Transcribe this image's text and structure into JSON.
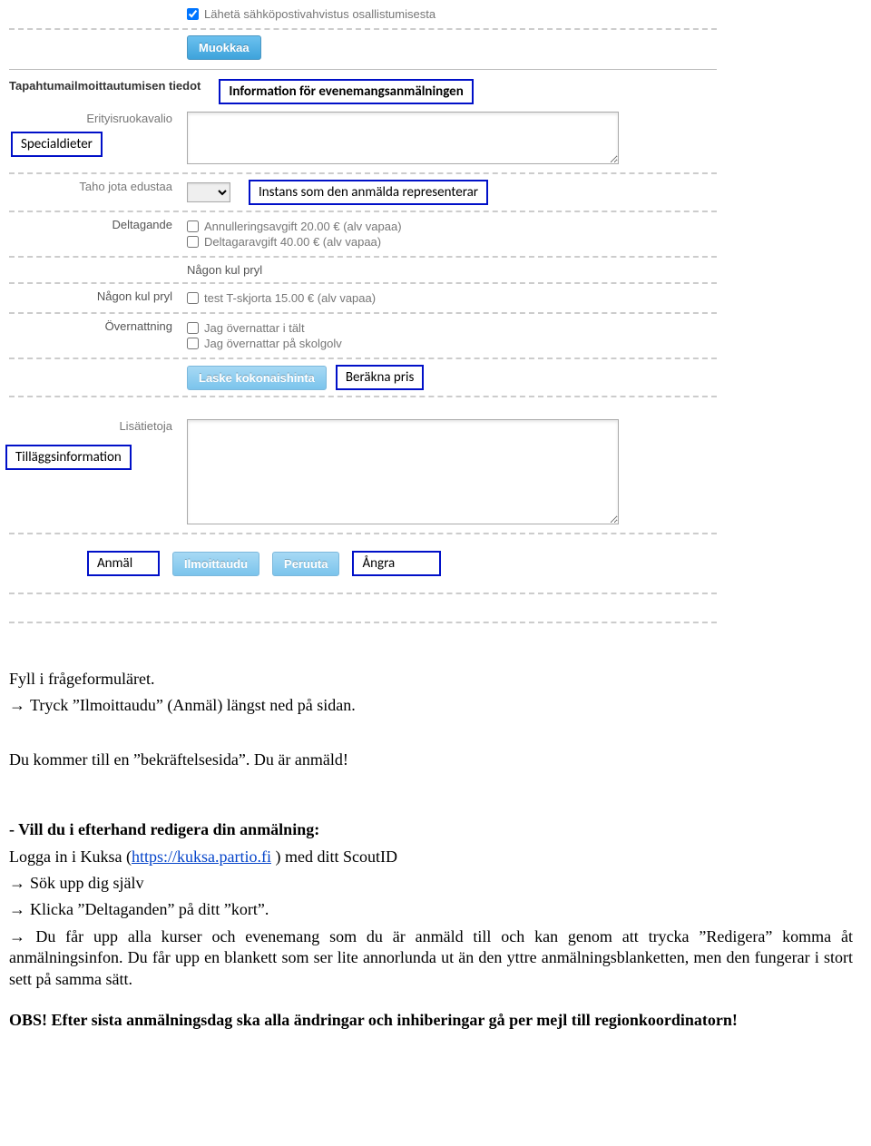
{
  "row_email": {
    "label": "Lähetä sähköpostivahvistus osallistumisesta"
  },
  "btn_muokkaa": "Muokkaa",
  "section_info": {
    "title": "Tapahtumailmoittautumisen tiedot",
    "callout": "Information för evenemangsanmälningen"
  },
  "row_diet": {
    "label": "Erityisruokavalio",
    "callout": "Specialdieter"
  },
  "row_represent": {
    "label": "Taho jota edustaa",
    "callout": "Instans som den anmälda representerar"
  },
  "row_participation": {
    "label": "Deltagande",
    "opt1": "Annulleringsavgift 20.00 € (alv vapaa)",
    "opt2": "Deltagaravgift 40.00 € (alv vapaa)"
  },
  "row_pryl_header": "Någon kul pryl",
  "row_pryl": {
    "label": "Någon kul pryl",
    "opt": "test T-skjorta 15.00 € (alv vapaa)"
  },
  "row_overnight": {
    "label": "Övernattning",
    "opt1": "Jag övernattar i tält",
    "opt2": "Jag övernattar på skolgolv"
  },
  "btn_calc": "Laske kokonaishinta",
  "calc_callout": "Beräkna pris",
  "row_info": {
    "label": "Lisätietoja",
    "callout": "Tilläggsinformation"
  },
  "submit": {
    "anmal_callout": "Anmäl",
    "ilmoittaudu": "Ilmoittaudu",
    "peruuta": "Peruuta",
    "angra_callout": "Ångra"
  },
  "doc": {
    "p1": "Fyll i frågeformuläret.",
    "p2": "Tryck ”Ilmoittaudu” (Anmäl) längst ned på sidan.",
    "p3": "Du kommer till en ”bekräftelsesida”. Du är anmäld!",
    "h1": "- Vill du i efterhand redigera din anmälning:",
    "p4a": "Logga in i Kuksa (",
    "p4link": "https://kuksa.partio.fi",
    "p4b": " ) med ditt ScoutID",
    "p5": "Sök upp dig själv",
    "p6": "Klicka ”Deltaganden” på ditt ”kort”.",
    "p7": "Du får upp alla kurser och evenemang som du är anmäld till och kan genom att trycka ”Redigera” komma åt anmälningsinfon. Du får upp en blankett som ser lite annorlunda ut än den yttre anmälningsblanketten, men den fungerar i stort sett på samma sätt.",
    "p8": "OBS! Efter sista anmälningsdag ska alla ändringar och inhiberingar gå per mejl till regionkoordinatorn!"
  }
}
